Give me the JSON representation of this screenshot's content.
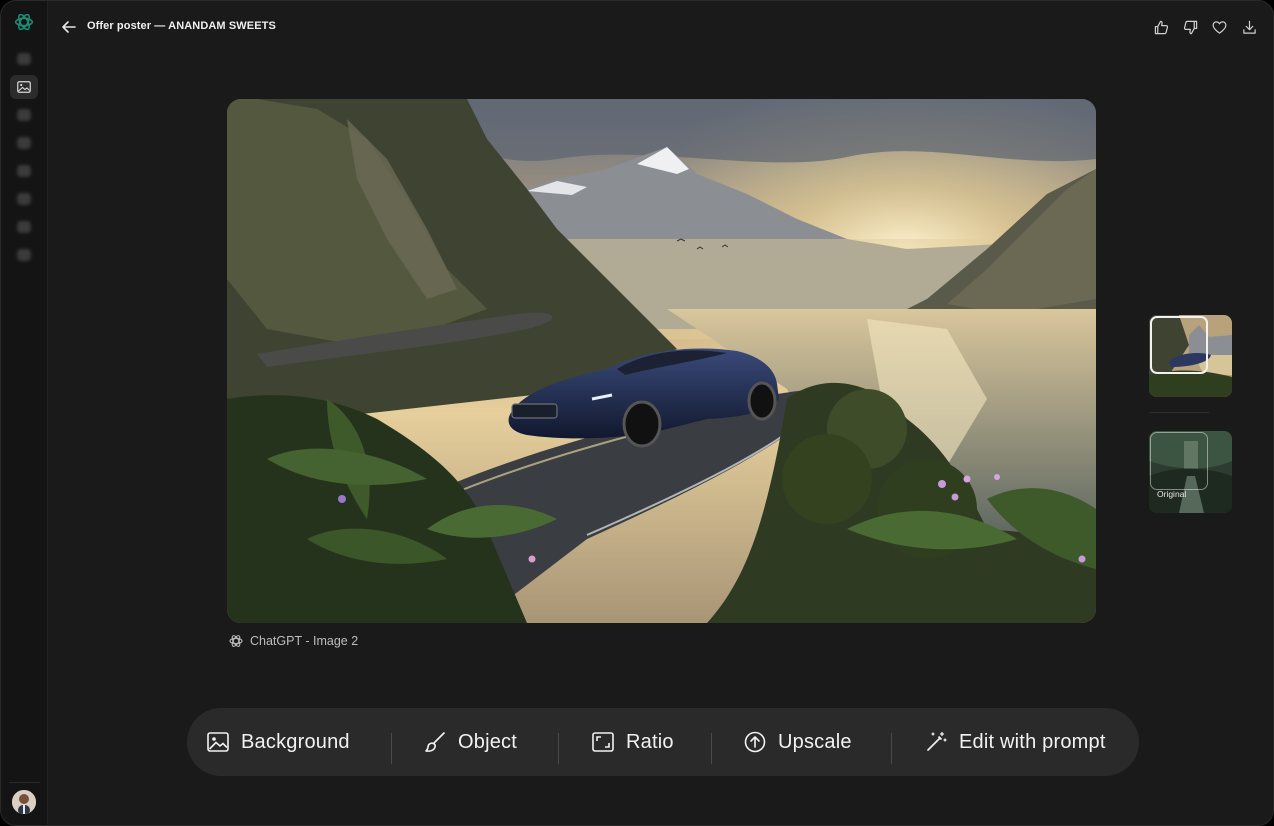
{
  "app": {
    "logo": "chatgpt-logo-icon",
    "accent": "#1d8a76"
  },
  "header": {
    "title": "Offer poster — ANANDAM SWEETS",
    "icons": [
      "arrow-left-icon",
      "thumbs-up-icon",
      "thumbs-down-icon",
      "heart-icon",
      "download-icon"
    ]
  },
  "rail": {
    "items": [
      "new-chat-icon",
      "image-icon",
      "item-icon",
      "item-icon",
      "item-icon",
      "item-icon",
      "item-icon",
      "item-icon"
    ],
    "active_index": 1
  },
  "image": {
    "caption": "ChatGPT - Image 2",
    "subject": "dark blue sports car on mountain coastal road at sunset"
  },
  "thumbnails": [
    {
      "label": "",
      "selected": true
    },
    {
      "label": "Original",
      "selected": false
    }
  ],
  "toolbar": {
    "background_label": "Background",
    "object_label": "Object",
    "ratio_label": "Ratio",
    "upscale_label": "Upscale",
    "edit_label": "Edit with prompt"
  },
  "colors": {
    "bg": "#1a1a1a",
    "toolbar": "#2a2a2a",
    "text": "#f2f2f2"
  }
}
